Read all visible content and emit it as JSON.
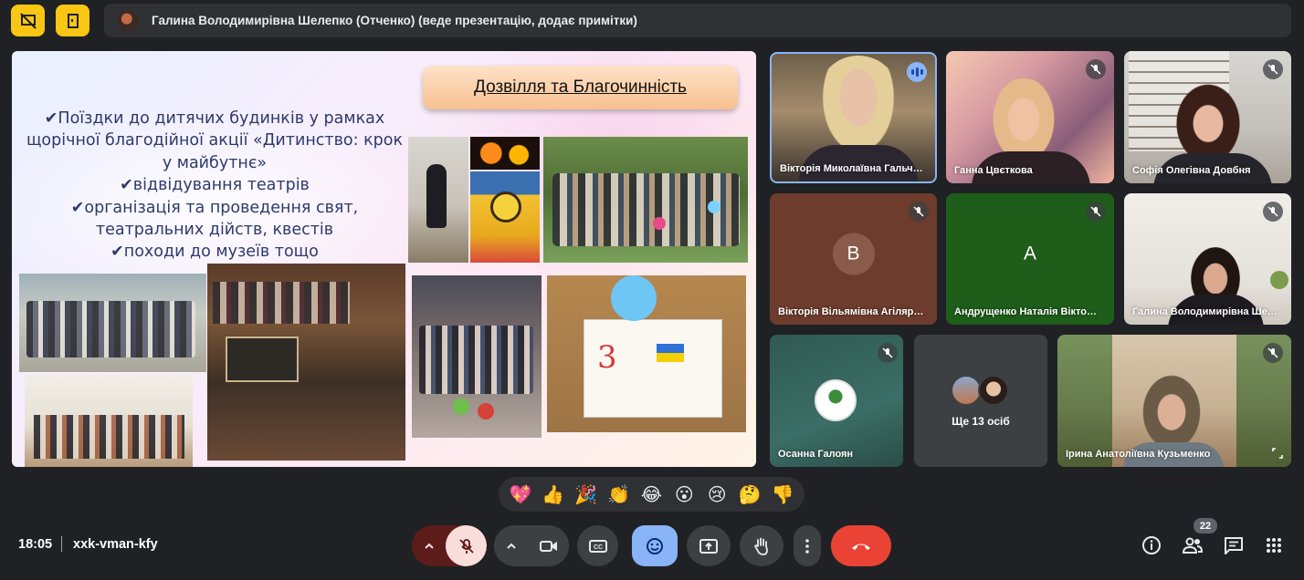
{
  "top_bar": {
    "presenter_banner": "Галина Володимирівна Шелепко (Отченко) (веде презентацію, додає примітки)"
  },
  "slide": {
    "title": "Дозвілля та Благочинність",
    "bullets": [
      "✔Поїздки до дитячих будинків у рамках",
      "щорічної благодійної акції «Дитинство: крок",
      "у майбутнє»",
      "✔відвідування театрів",
      "✔організація та проведення свят,",
      "театральних дійств, квестів",
      "✔походи до музеїв тощо"
    ]
  },
  "participants": [
    {
      "name": "Вікторія Миколаївна Гальч…",
      "status": "speaking"
    },
    {
      "name": "Ганна Цвєткова",
      "status": "muted"
    },
    {
      "name": "Софія Олегівна Довбня",
      "status": "muted"
    },
    {
      "name": "Вікторія Вільямівна Агіляр…",
      "initial": "В",
      "status": "muted",
      "color": "#6d3c2c"
    },
    {
      "name": "Андрущенко Наталія Вікто…",
      "initial": "А",
      "status": "muted",
      "color": "#1e5d1a"
    },
    {
      "name": "Галина Володимирівна Ше…",
      "status": "muted"
    },
    {
      "name": "Осанна Галоян",
      "status": "muted"
    },
    {
      "name": "Ще 13 осіб",
      "status": "overflow"
    },
    {
      "name": "Ірина Анатоліївна Кузьменко",
      "status": "muted"
    }
  ],
  "reactions": [
    "💖",
    "👍",
    "🎉",
    "👏",
    "😂",
    "😮",
    "😢",
    "🤔",
    "👎"
  ],
  "bottom_bar": {
    "time": "18:05",
    "meeting_code": "xxk-vman-kfy",
    "people_count": "22"
  },
  "colors": {
    "background": "#202124",
    "warning_button": "#f9c613",
    "end_call": "#ea4335",
    "mic_muted": "#f9dedc",
    "reaction_active": "#8ab4f8"
  },
  "icons": {
    "top_left_1": "presentation-off-icon",
    "top_left_2": "door-exit-icon"
  }
}
